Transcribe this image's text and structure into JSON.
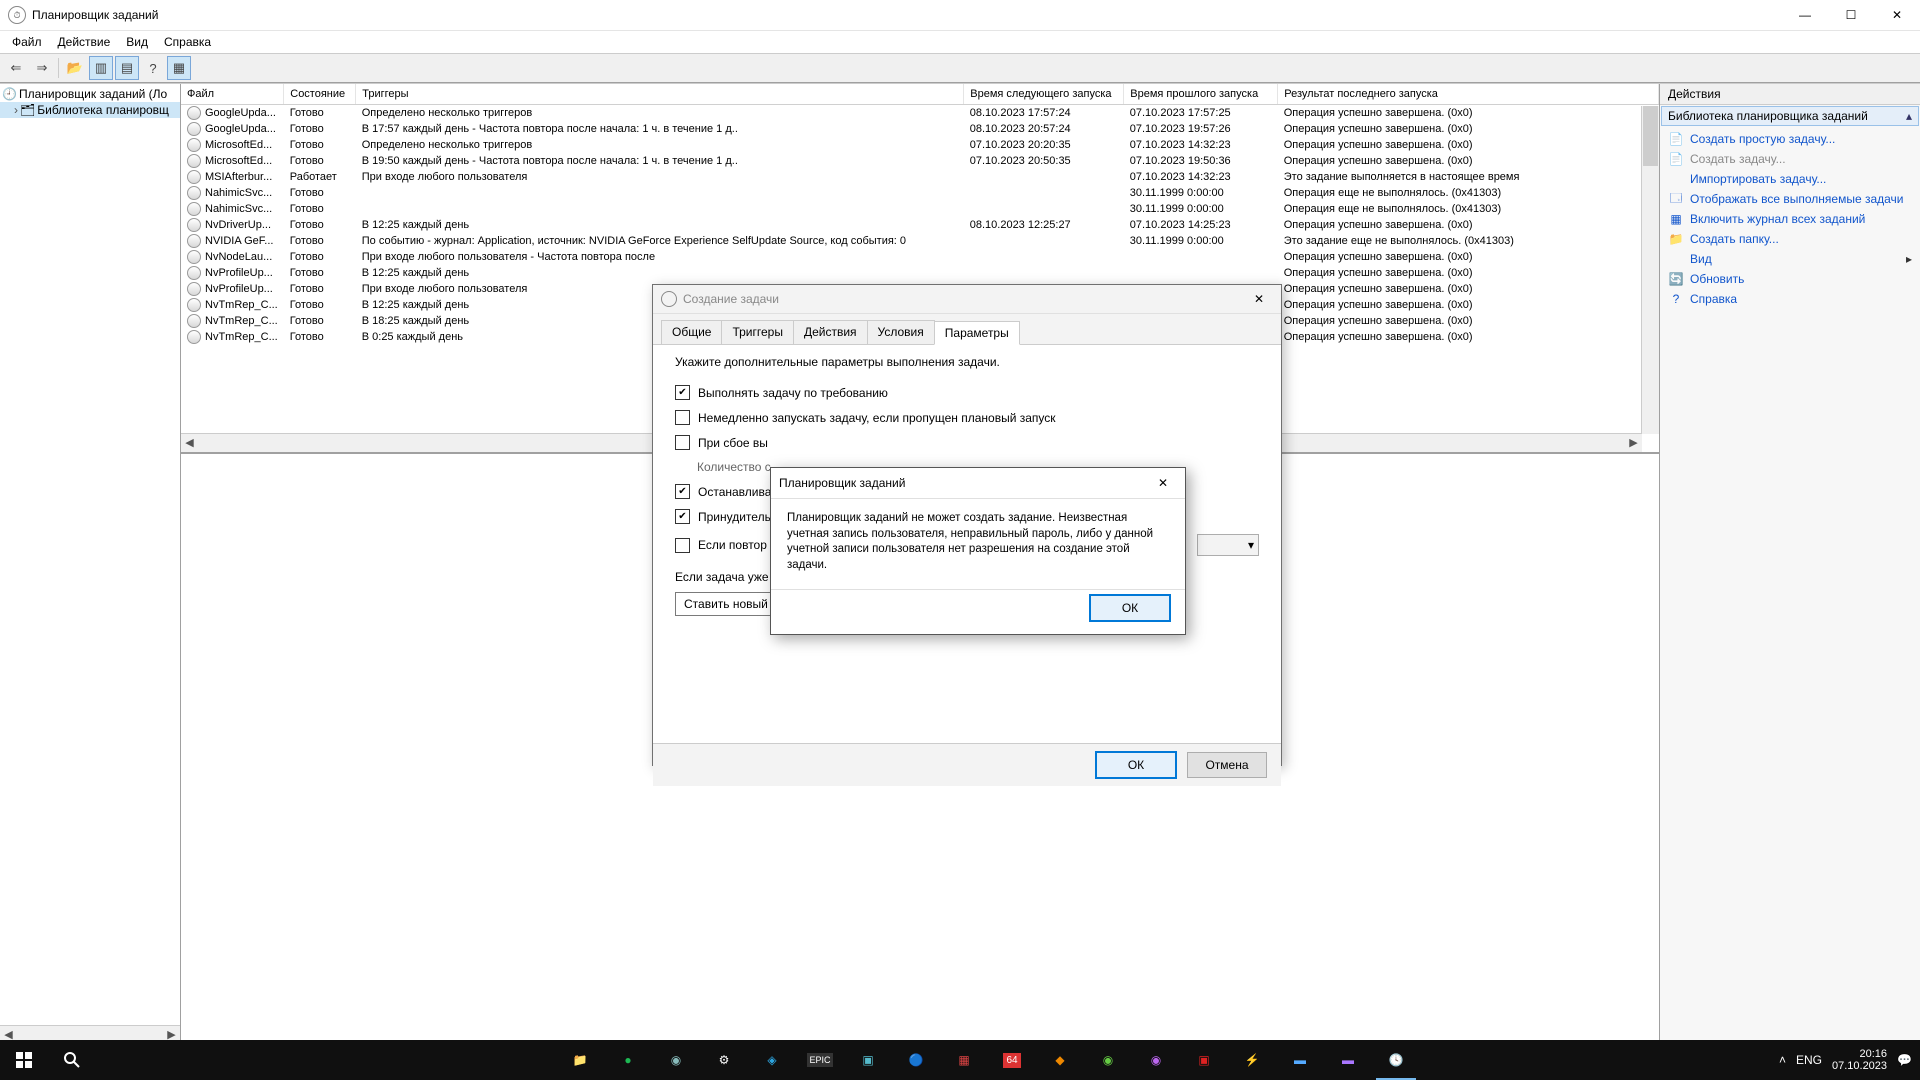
{
  "window": {
    "title": "Планировщик заданий"
  },
  "menubar": [
    "Файл",
    "Действие",
    "Вид",
    "Справка"
  ],
  "tree": {
    "root": "Планировщик заданий (Ло",
    "child": "Библиотека планировщ"
  },
  "columns": [
    "Файл",
    "Состояние",
    "Триггеры",
    "Время следующего запуска",
    "Время прошлого запуска",
    "Результат последнего запуска"
  ],
  "tasks": [
    {
      "name": "GoogleUpda...",
      "state": "Готово",
      "trigger": "Определено несколько триггеров",
      "next": "08.10.2023 17:57:24",
      "prev": "07.10.2023 17:57:25",
      "result": "Операция успешно завершена. (0x0)"
    },
    {
      "name": "GoogleUpda...",
      "state": "Готово",
      "trigger": "В 17:57 каждый день - Частота повтора после начала: 1 ч. в течение 1 д..",
      "next": "08.10.2023 20:57:24",
      "prev": "07.10.2023 19:57:26",
      "result": "Операция успешно завершена. (0x0)"
    },
    {
      "name": "MicrosoftEd...",
      "state": "Готово",
      "trigger": "Определено несколько триггеров",
      "next": "07.10.2023 20:20:35",
      "prev": "07.10.2023 14:32:23",
      "result": "Операция успешно завершена. (0x0)"
    },
    {
      "name": "MicrosoftEd...",
      "state": "Готово",
      "trigger": "В 19:50 каждый день - Частота повтора после начала: 1 ч. в течение 1 д..",
      "next": "07.10.2023 20:50:35",
      "prev": "07.10.2023 19:50:36",
      "result": "Операция успешно завершена. (0x0)"
    },
    {
      "name": "MSIAfterbur...",
      "state": "Работает",
      "trigger": "При входе любого пользователя",
      "next": "",
      "prev": "07.10.2023 14:32:23",
      "result": "Это задание выполняется в настоящее время"
    },
    {
      "name": "NahimicSvc...",
      "state": "Готово",
      "trigger": "",
      "next": "",
      "prev": "30.11.1999 0:00:00",
      "result": "Операция еще не выполнялось. (0x41303)"
    },
    {
      "name": "NahimicSvc...",
      "state": "Готово",
      "trigger": "",
      "next": "",
      "prev": "30.11.1999 0:00:00",
      "result": "Операция еще не выполнялось. (0x41303)"
    },
    {
      "name": "NvDriverUp...",
      "state": "Готово",
      "trigger": "В 12:25 каждый день",
      "next": "08.10.2023 12:25:27",
      "prev": "07.10.2023 14:25:23",
      "result": "Операция успешно завершена. (0x0)"
    },
    {
      "name": "NVIDIA GeF...",
      "state": "Готово",
      "trigger": "По событию - журнал: Application, источник: NVIDIA GeForce Experience SelfUpdate Source, код события: 0",
      "next": "",
      "prev": "30.11.1999 0:00:00",
      "result": "Это задание еще не выполнялось. (0x41303)"
    },
    {
      "name": "NvNodeLau...",
      "state": "Готово",
      "trigger": "При входе любого пользователя - Частота повтора после",
      "next": "",
      "prev": "",
      "result": "Операция успешно завершена. (0x0)"
    },
    {
      "name": "NvProfileUp...",
      "state": "Готово",
      "trigger": "В 12:25 каждый день",
      "next": "",
      "prev": "",
      "result": "Операция успешно завершена. (0x0)"
    },
    {
      "name": "NvProfileUp...",
      "state": "Готово",
      "trigger": "При входе любого пользователя",
      "next": "",
      "prev": "",
      "result": "Операция успешно завершена. (0x0)"
    },
    {
      "name": "NvTmRep_C...",
      "state": "Готово",
      "trigger": "В 12:25 каждый день",
      "next": "",
      "prev": "",
      "result": "Операция успешно завершена. (0x0)"
    },
    {
      "name": "NvTmRep_C...",
      "state": "Готово",
      "trigger": "В 18:25 каждый день",
      "next": "",
      "prev": "",
      "result": "Операция успешно завершена. (0x0)"
    },
    {
      "name": "NvTmRep_C...",
      "state": "Готово",
      "trigger": "В 0:25 каждый день",
      "next": "",
      "prev": "",
      "result": "Операция успешно завершена. (0x0)"
    }
  ],
  "actions": {
    "header": "Действия",
    "section": "Библиотека планировщика заданий",
    "items": [
      {
        "id": "create-basic",
        "label": "Создать простую задачу...",
        "ico": "📄",
        "dis": false
      },
      {
        "id": "create-task",
        "label": "Создать задачу...",
        "ico": "📄",
        "dis": true
      },
      {
        "id": "import",
        "label": "Импортировать задачу...",
        "ico": "",
        "dis": false
      },
      {
        "id": "show-running",
        "label": "Отображать все выполняемые задачи",
        "ico": "🗔",
        "dis": false
      },
      {
        "id": "enable-history",
        "label": "Включить журнал всех заданий",
        "ico": "▦",
        "dis": false
      },
      {
        "id": "new-folder",
        "label": "Создать папку...",
        "ico": "📁",
        "dis": false
      },
      {
        "id": "view",
        "label": "Вид",
        "ico": "",
        "dis": false,
        "arrow": true
      },
      {
        "id": "refresh",
        "label": "Обновить",
        "ico": "🔄",
        "dis": false
      },
      {
        "id": "help",
        "label": "Справка",
        "ico": "?",
        "dis": false
      }
    ]
  },
  "dlg_create": {
    "title": "Создание задачи",
    "tabs": [
      "Общие",
      "Триггеры",
      "Действия",
      "Условия",
      "Параметры"
    ],
    "active_tab": 4,
    "intro": "Укажите дополнительные параметры выполнения задачи.",
    "ck1": "Выполнять задачу по требованию",
    "ck2": "Немедленно запускать задачу, если пропущен плановый запуск",
    "ck3": "При сбое вы",
    "ck3sub": "Количество с",
    "ck4": "Останавлива",
    "ck5": "Принудитель",
    "ck6": "Если повтор",
    "rule_label": "Если задача уже выполняется, то применять правило:",
    "rule_value": "Ставить новый экземпляр задания в очередь",
    "ok": "ОК",
    "cancel": "Отмена"
  },
  "dlg_error": {
    "title": "Планировщик заданий",
    "msg": "Планировщик заданий не может создать задание. Неизвестная учетная запись пользователя, неправильный пароль, либо у данной учетной записи пользователя нет разрешения на создание этой задачи.",
    "ok": "ОК"
  },
  "tray": {
    "lang": "ENG",
    "time": "20:16",
    "date": "07.10.2023"
  }
}
